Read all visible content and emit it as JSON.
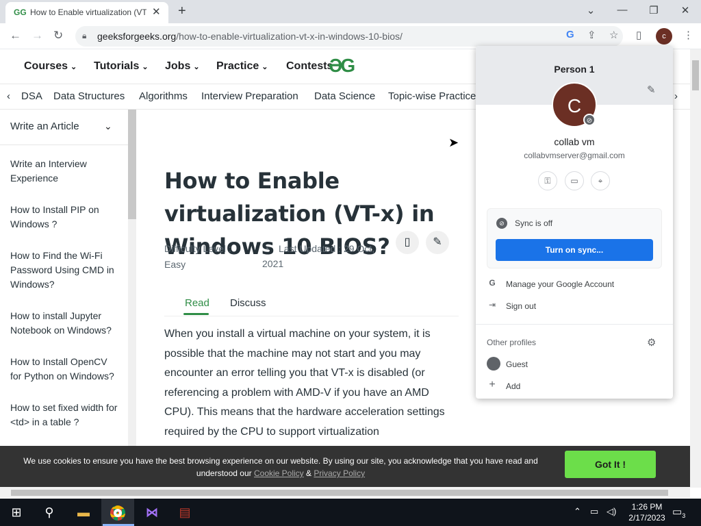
{
  "browser": {
    "tab_title": "How to Enable virtualization (VT-",
    "tab_favicon": "GG",
    "tab_close": "✕",
    "new_tab": "+",
    "url_domain": "geeksforgeeks.org",
    "url_path": "/how-to-enable-virtualization-vt-x-in-windows-10-bios/",
    "profile_initial": "c",
    "window_controls": [
      "⌄",
      "—",
      "❐",
      "✕"
    ]
  },
  "site": {
    "main_nav": [
      "Courses",
      "Tutorials",
      "Jobs",
      "Practice",
      "Contests"
    ],
    "logo": "ƏG",
    "sub_nav": [
      "DSA",
      "Data Structures",
      "Algorithms",
      "Interview Preparation",
      "Data Science",
      "Topic-wise Practice"
    ],
    "sidebar_heading": "Write an Article",
    "sidebar_links": [
      "Write an Interview Experience",
      "How to Install PIP on Windows ?",
      "How to Find the Wi-Fi Password Using CMD in Windows?",
      "How to install Jupyter Notebook on Windows?",
      "How to Install OpenCV for Python on Windows?",
      "How to set fixed width for <td> in a table ?"
    ]
  },
  "article": {
    "title": "How to Enable virtualization (VT-x) in Windows 10 BIOS?",
    "difficulty_label": "Difficulty Level :",
    "difficulty_value": "Easy",
    "last_updated": "Last Updated : 29 Oct, 2021",
    "tab_read": "Read",
    "tab_discuss": "Discuss",
    "body": "When you install a virtual machine on your system, it is possible that the machine may not start and you may encounter an error telling you that VT-x is disabled (or referencing a problem with AMD-V if you have an AMD CPU). This means that the hardware acceleration settings required by the CPU to support virtualization"
  },
  "cookie": {
    "text": "We use cookies to ensure you have the best browsing experience on our website. By using our site, you acknowledge that you have read and understood our",
    "cookie_policy": "Cookie Policy",
    "amp": "&",
    "privacy_policy": "Privacy Policy",
    "button": "Got It !"
  },
  "profile_menu": {
    "header": "Person 1",
    "avatar_initial": "C",
    "name": "collab vm",
    "email": "collabvmserver@gmail.com",
    "sync_status": "Sync is off",
    "sync_button": "Turn on sync...",
    "manage_account": "Manage your Google Account",
    "sign_out": "Sign out",
    "other_profiles": "Other profiles",
    "guest": "Guest",
    "add": "Add"
  },
  "taskbar": {
    "time": "1:26 PM",
    "date": "2/17/2023",
    "notifications": "3"
  },
  "colors": {
    "gfg_green": "#2f8d46",
    "sync_blue": "#1a73e8",
    "cookie_button": "#6cde4a",
    "profile_avatar": "#6b2f24"
  }
}
